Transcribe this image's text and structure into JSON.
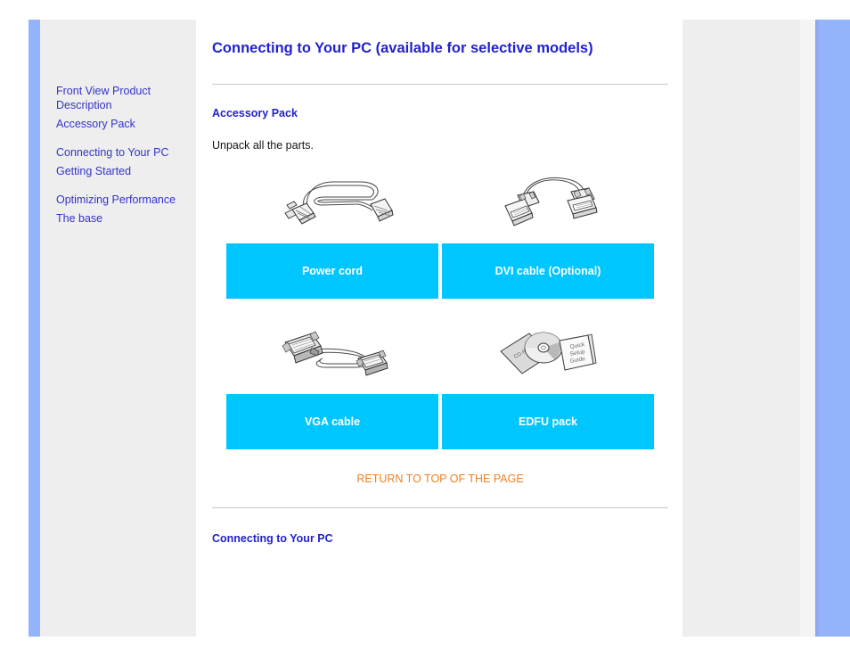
{
  "page": {
    "title": "Connecting to Your PC (available for selective models)"
  },
  "sidebar": {
    "groups": [
      {
        "items": [
          {
            "label": "Front View Product Description",
            "name": "sidebar-link-front-view-product-description"
          },
          {
            "label": "Accessory Pack",
            "name": "sidebar-link-accessory-pack"
          }
        ]
      },
      {
        "items": [
          {
            "label": "Connecting to Your PC",
            "name": "sidebar-link-connecting-to-your-pc"
          },
          {
            "label": "Getting Started",
            "name": "sidebar-link-getting-started"
          }
        ]
      },
      {
        "items": [
          {
            "label": "Optimizing Performance",
            "name": "sidebar-link-optimizing-performance"
          },
          {
            "label": "The base",
            "name": "sidebar-link-the-base"
          }
        ]
      }
    ]
  },
  "main": {
    "accessory_heading": "Accessory Pack",
    "intro_text": "Unpack all the parts.",
    "figures": [
      {
        "icon": "power-cord-illustration",
        "caption": "Power cord"
      },
      {
        "icon": "dvi-cable-illustration",
        "caption": "DVI cable (Optional)"
      },
      {
        "icon": "vga-cable-illustration",
        "caption": "VGA cable"
      },
      {
        "icon": "edfu-pack-illustration",
        "caption": "EDFU pack"
      }
    ],
    "edfu_labels": {
      "cd_sleeve": "CD-ROM",
      "booklet_line1": "Quick",
      "booklet_line2": "Setup",
      "booklet_line3": "Guide"
    },
    "return_link": "RETURN TO TOP OF THE PAGE",
    "connecting_heading": "Connecting to Your PC"
  },
  "colors": {
    "heading_blue": "#2222cc",
    "link_blue": "#3333cc",
    "caption_cyan": "#00c6ff",
    "return_orange": "#f08020",
    "rail_blue": "#93b4fb",
    "panel_grey": "#eeeeee"
  }
}
